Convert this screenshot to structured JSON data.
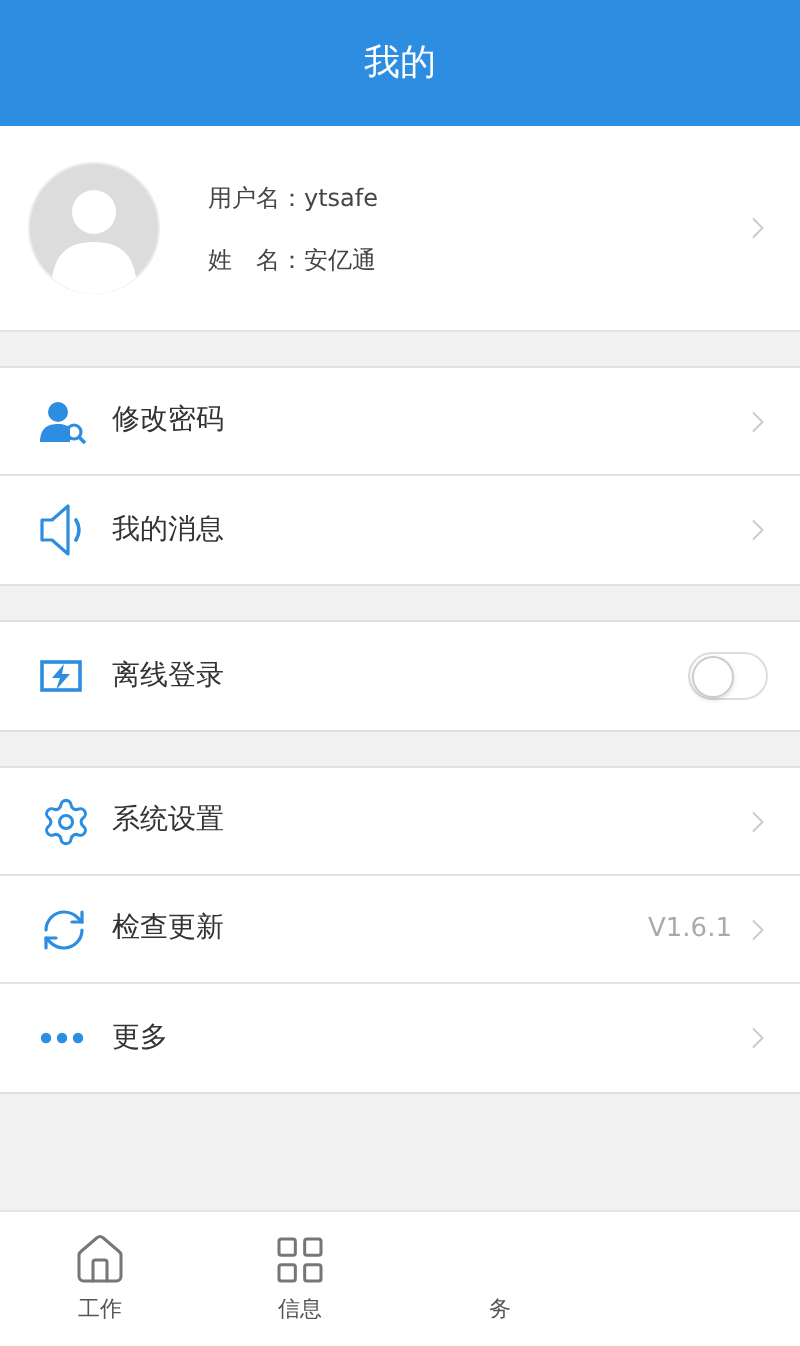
{
  "header": {
    "title": "我的"
  },
  "profile": {
    "username_label": "用户名：",
    "username": "ytsafe",
    "name_label": "姓　名：",
    "name": "安亿通"
  },
  "sections": [
    {
      "items": [
        {
          "kind": "link",
          "label": "修改密码"
        },
        {
          "kind": "link",
          "label": "我的消息"
        }
      ]
    },
    {
      "items": [
        {
          "kind": "toggle",
          "label": "离线登录",
          "on": false
        }
      ]
    },
    {
      "items": [
        {
          "kind": "link",
          "label": "系统设置"
        },
        {
          "kind": "link",
          "label": "检查更新",
          "value": "V1.6.1"
        },
        {
          "kind": "link",
          "label": "更多"
        }
      ]
    }
  ],
  "tab_bar": [
    {
      "label": "工作"
    },
    {
      "label": "信息"
    },
    {
      "label": "务"
    }
  ]
}
